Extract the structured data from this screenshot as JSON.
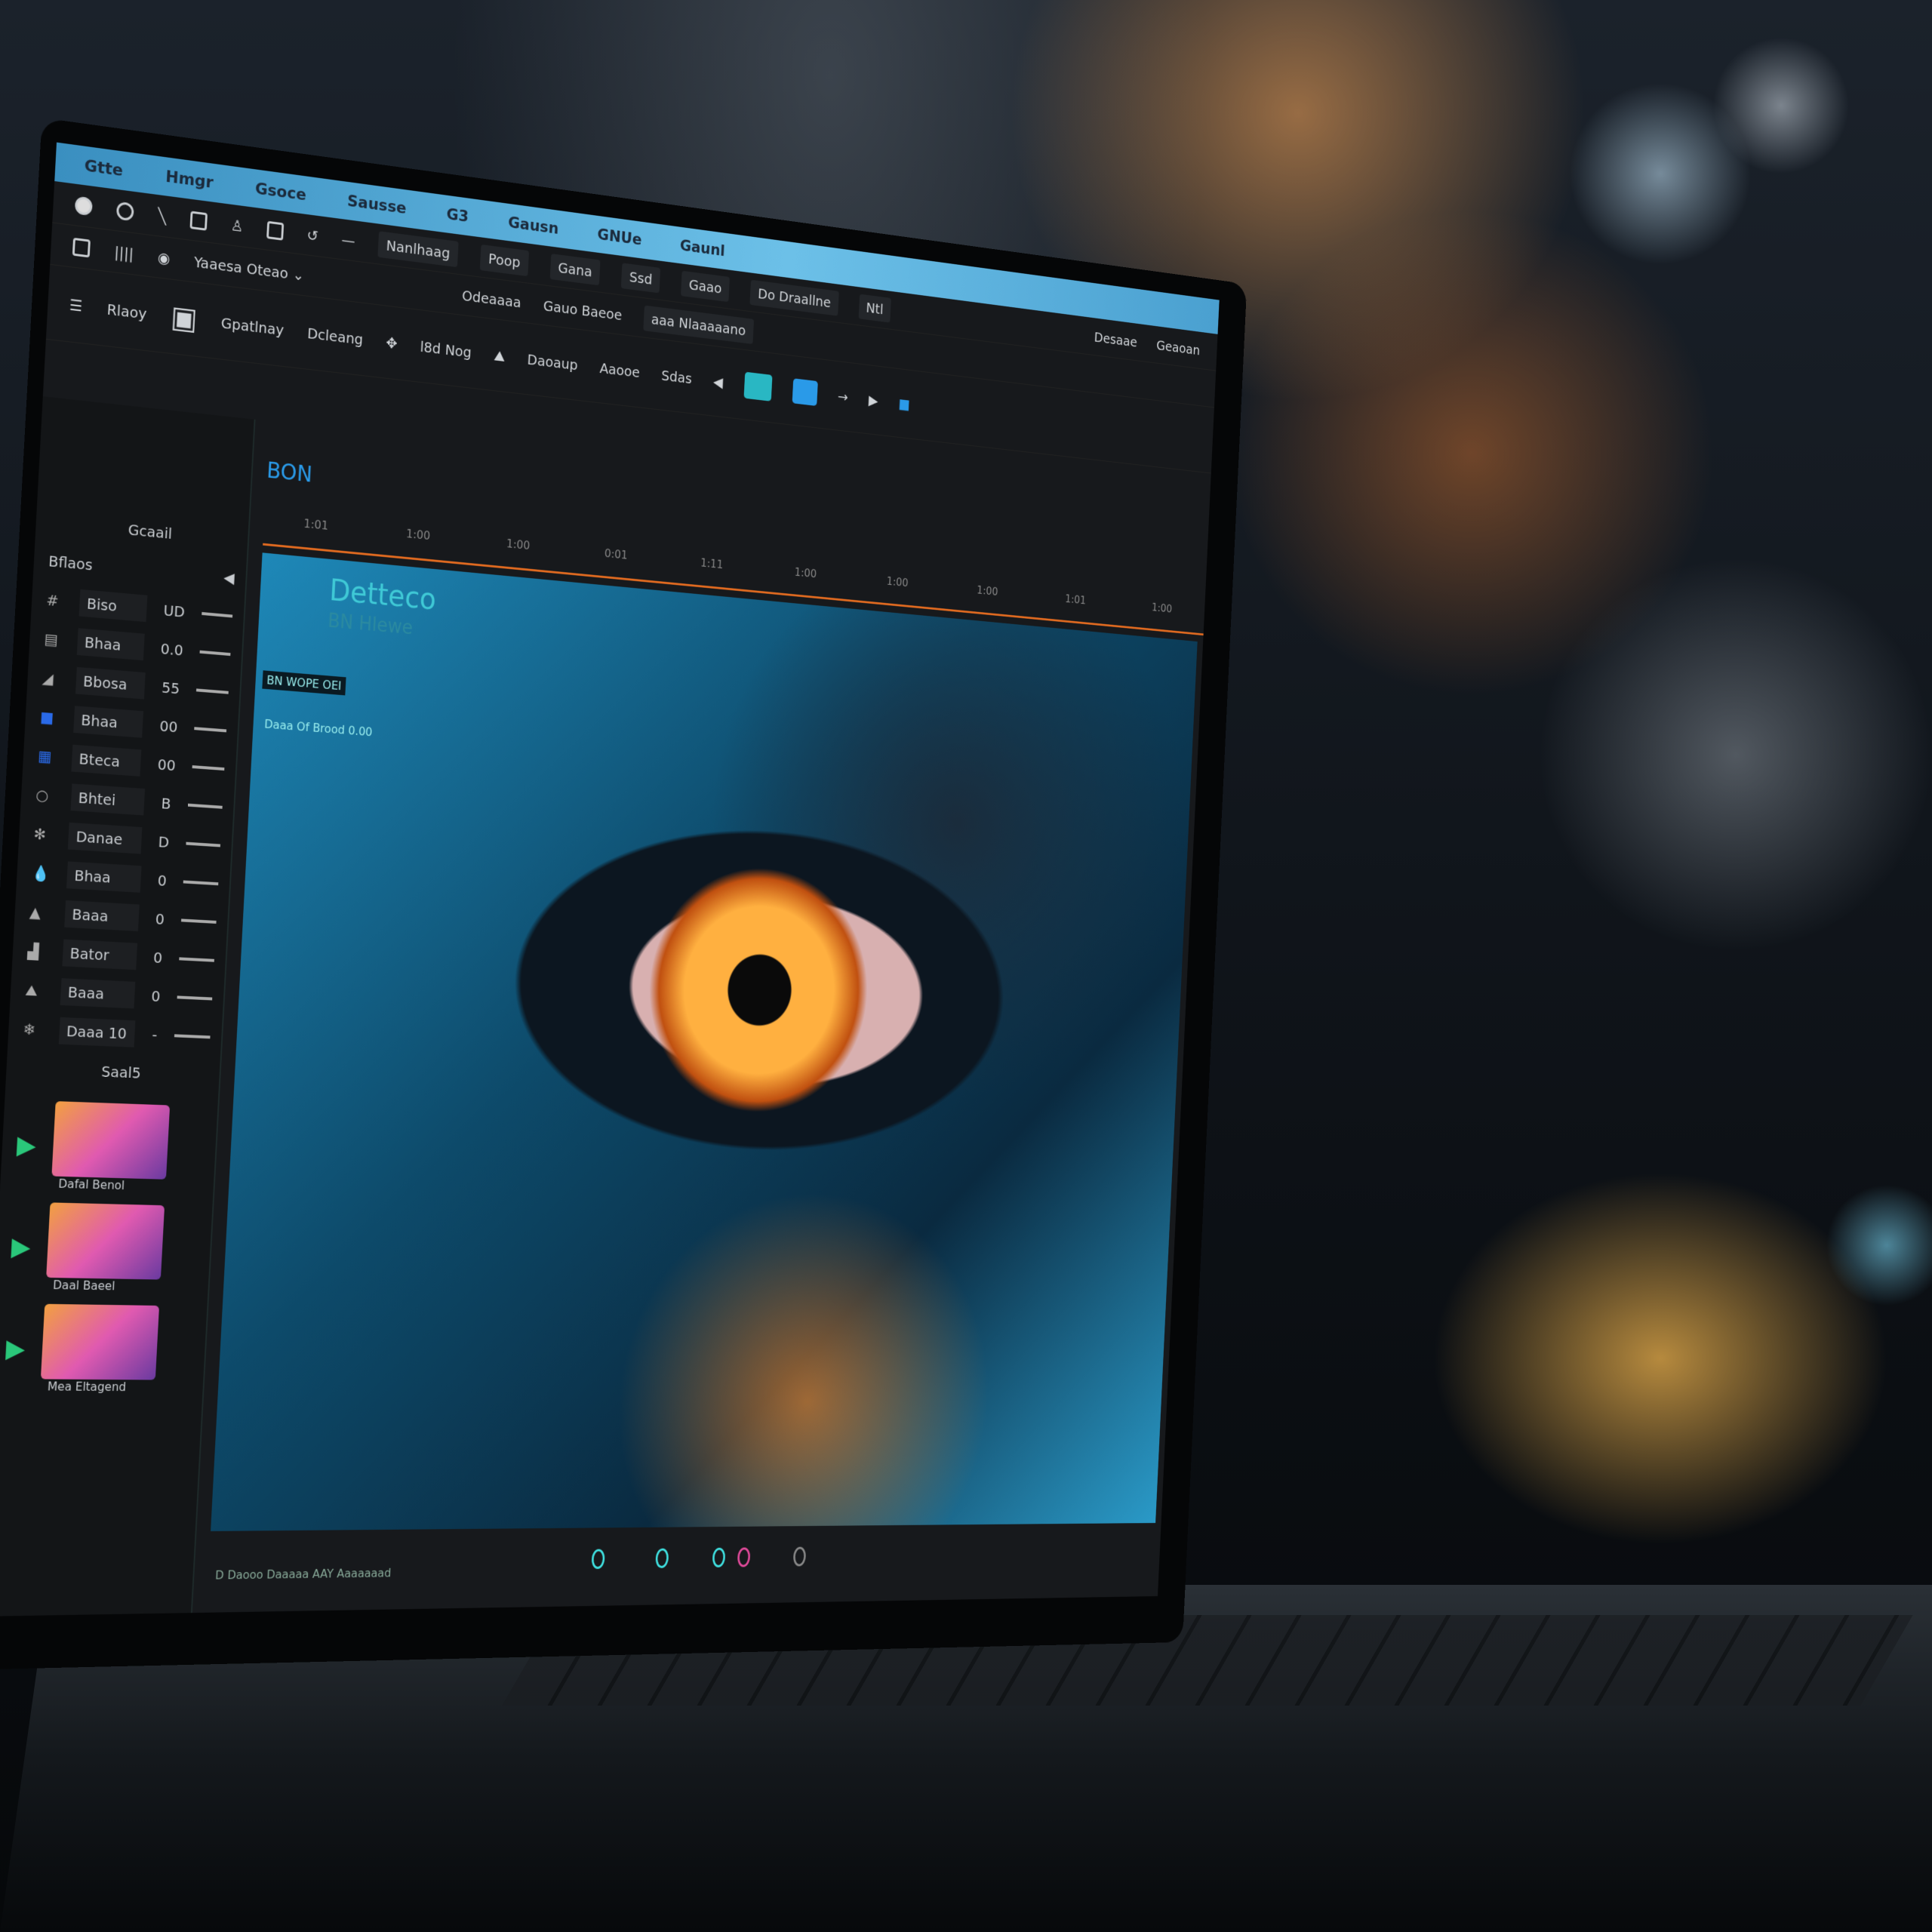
{
  "menu": [
    "Gtte",
    "Hmgr",
    "Gsoce",
    "Sausse",
    "G3",
    "Gausn",
    "GNUe",
    "Gaunl"
  ],
  "toolbar1": {
    "items": [
      "Nanlhaag",
      "Poop",
      "Gana",
      "Ssd",
      "Gaao",
      "Do Draallne",
      "Ntl"
    ],
    "right": [
      "Desaae",
      "Geaoan"
    ]
  },
  "toolbar2": {
    "dropdown": "Yaaesa Oteao",
    "right": "Odeaaaa",
    "extra": [
      "Gauo Baeoe",
      "aaa Nlaaaaano"
    ]
  },
  "toolbar3": {
    "label1": "Rlaoy",
    "label2": "Gpatlnay",
    "label3": "Dcleang",
    "label4": "l8d Nog",
    "label5": "Daoaup",
    "label6": "Aaooe",
    "label7": "Sdas"
  },
  "panel": {
    "header": "Gcaail",
    "subheader": "Bflaos",
    "rows": [
      {
        "icon": "hash",
        "name": "Biso",
        "val": "UD"
      },
      {
        "icon": "layers",
        "name": "Bhaa",
        "val": "0.0"
      },
      {
        "icon": "triangle",
        "name": "Bbosa",
        "val": "55"
      },
      {
        "icon": "square-blue",
        "name": "Bhaa",
        "val": "00"
      },
      {
        "icon": "grid-blue",
        "name": "Bteca",
        "val": "00"
      },
      {
        "icon": "circle",
        "name": "Bhtei",
        "val": "B"
      },
      {
        "icon": "asterisk",
        "name": "Danae",
        "val": "D"
      },
      {
        "icon": "drop",
        "name": "Bhaa",
        "val": "0"
      },
      {
        "icon": "stamp",
        "name": "Baaa",
        "val": "0"
      },
      {
        "icon": "chart",
        "name": "Bator",
        "val": "0"
      },
      {
        "icon": "mountain",
        "name": "Baaa",
        "val": "0"
      },
      {
        "icon": "snowflake",
        "name": "Daaa 10",
        "val": "-"
      }
    ],
    "clips_header": "Saal5",
    "clips": [
      "Dafal Benol",
      "Daal Baeel",
      "Mea Eltagend"
    ]
  },
  "timeline": {
    "label": "BON",
    "ticks": [
      "1:01",
      "1:00",
      "1:00",
      "0:01",
      "1:11",
      "1:00",
      "1:00",
      "1:00",
      "1:01",
      "1:00"
    ]
  },
  "canvas": {
    "title": "Detteco",
    "subtitle": "BN Hlewe",
    "label1": "BN WOPE OEI",
    "label2": "Daaa Of Brood 0.00"
  },
  "status": "D Daooo Daaaaa AAY Aaaaaaad",
  "colors": {
    "menubar": "#6cc0e8",
    "accent_teal": "#29b7c3",
    "timeline_orange": "#e06a20",
    "keyframe": "#3fe0e0"
  }
}
